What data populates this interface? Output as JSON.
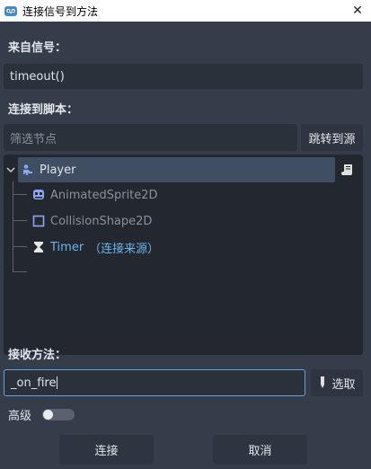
{
  "window": {
    "title": "连接信号到方法",
    "close_glyph": "✕"
  },
  "signal": {
    "label": "来自信号：",
    "value": "timeout()"
  },
  "script": {
    "label": "连接到脚本：",
    "filter_placeholder": "筛选节点",
    "goto_source_label": "跳转到源"
  },
  "tree": {
    "nodes": [
      {
        "label": "Player",
        "icon": "player-node-icon",
        "state": "selected"
      },
      {
        "label": "AnimatedSprite2D",
        "icon": "animated-sprite-icon",
        "state": "dim"
      },
      {
        "label": "CollisionShape2D",
        "icon": "collision-shape-icon",
        "state": "dim"
      },
      {
        "label": "Timer",
        "suffix": "（连接来源）",
        "icon": "hourglass-icon",
        "state": "source"
      }
    ],
    "script_icon": "script-icon"
  },
  "method": {
    "label": "接收方法：",
    "value": "_on_fire",
    "pick_label": "选取"
  },
  "advanced": {
    "label": "高级",
    "enabled": false
  },
  "actions": {
    "connect_label": "连接",
    "cancel_label": "取消"
  },
  "colors": {
    "background": "#363d4a",
    "tree_background": "#232830",
    "selection": "#3f4e63",
    "accent": "#66a3d9",
    "source_text": "#6eb4ec",
    "node_icon_blue": "#8da5f3"
  }
}
